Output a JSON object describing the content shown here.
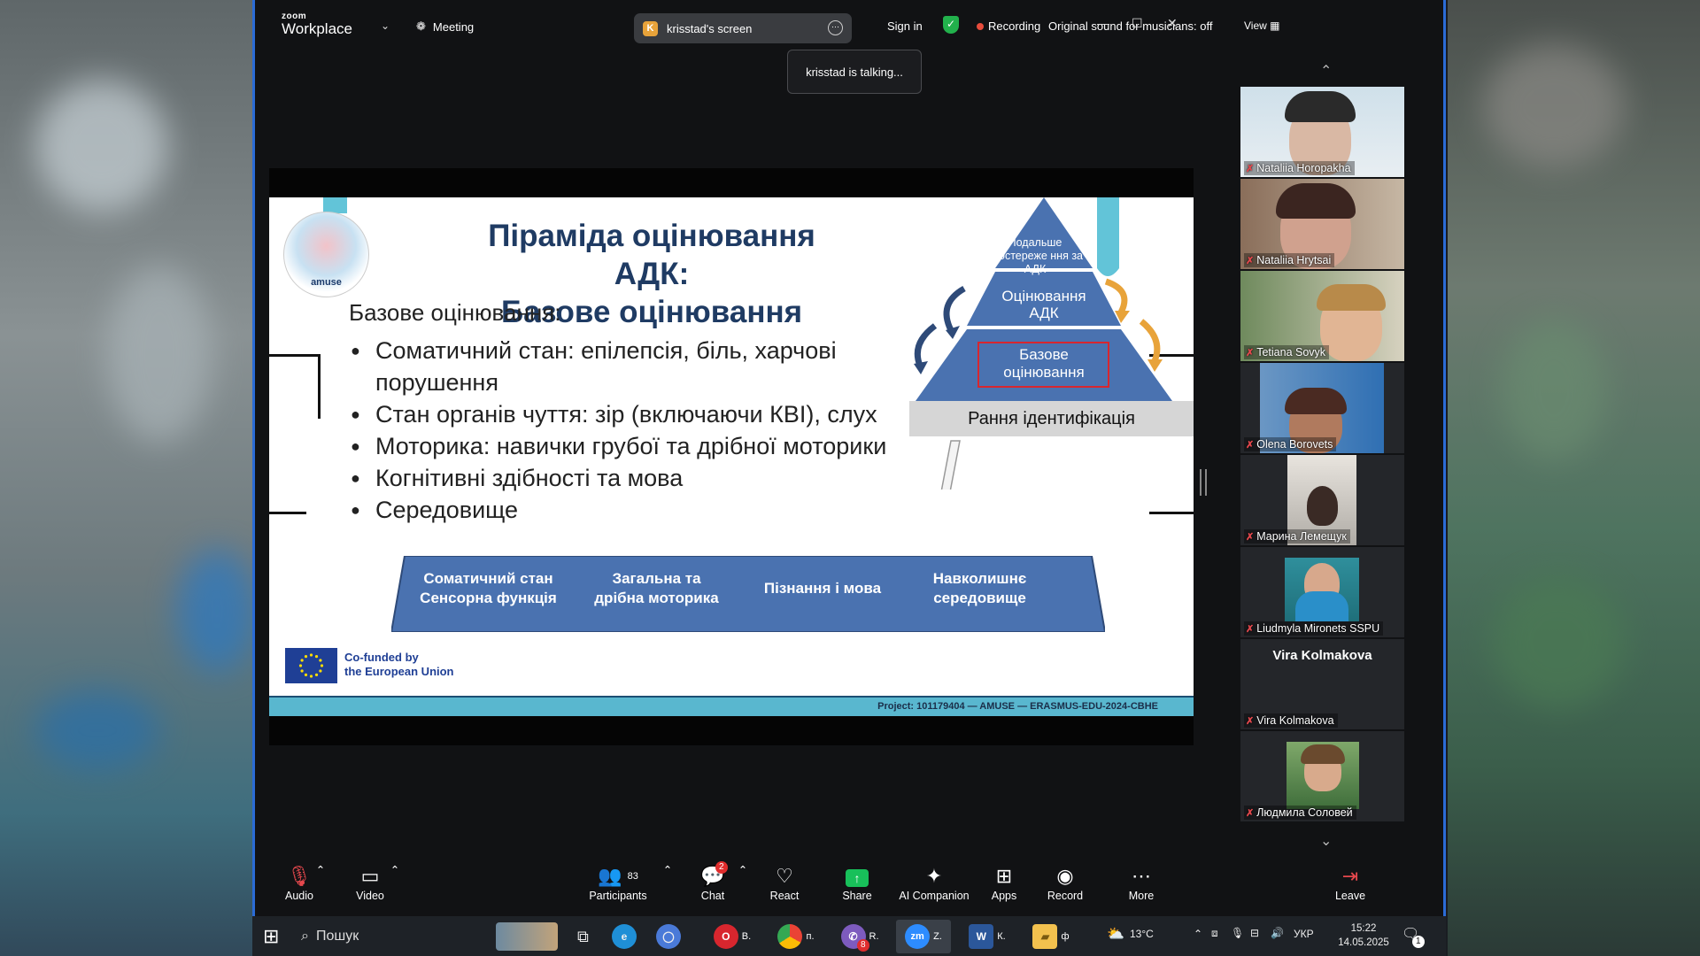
{
  "window": {
    "app_logo_small": "zoom",
    "app_logo_big": "Workplace",
    "meeting_label": "Meeting",
    "screen_pill_initial": "K",
    "screen_pill_label": "krisstad's screen",
    "sign_in": "Sign in",
    "recording": "Recording",
    "original_sound": "Original sound for musicians: off",
    "view": "View",
    "talking_tooltip": "krisstad is talking..."
  },
  "slide": {
    "title_line1": "Піраміда оцінювання АДК:",
    "title_line2": "Базове оцінювання",
    "logo_text": "amuse",
    "subheading": "Базове оцінювання:",
    "bullets": [
      "Соматичний стан: епілепсія, біль, харчові порушення",
      "Стан органів чуття: зір (включаючи КВІ), слух",
      "Моторика: навички грубої та дрібної моторики",
      "Когнітивні здібності та мова",
      "Середовище"
    ],
    "pyramid": {
      "top": "Подальше спостереже ння за АДК",
      "middle": "Оцінювання АДК",
      "bottom": "Базове оцінювання",
      "base_band": "Рання ідентифікація"
    },
    "bottom_labels": [
      "Соматичний стан Сенсорна функція",
      "Загальна та дрібна моторика",
      "Пізнання і мова",
      "Навколишнє середовище"
    ],
    "eu_text_line1": "Co-funded by",
    "eu_text_line2": "the European Union",
    "project_footer": "Project: 101179404 — AMUSE — ERASMUS-EDU-2024-CBHE",
    "colors": {
      "title": "#1f3b63",
      "pyramid": "#4a72b0",
      "band": "#59b7cf",
      "arrow_orange": "#e8a33a"
    }
  },
  "participants": {
    "tiles": [
      {
        "name": "Nataliia Horopakha"
      },
      {
        "name": "Nataliia Hrytsai"
      },
      {
        "name": "Tetiana Sovyk"
      },
      {
        "name": "Olena Borovets"
      },
      {
        "name": "Марина Лемещук"
      },
      {
        "name": "Liudmyla Mironets SSPU"
      },
      {
        "name": "Vira Kolmakova",
        "display_title": "Vira Kolmakova"
      },
      {
        "name": "Людмила Соловей"
      }
    ]
  },
  "toolbar": {
    "audio": "Audio",
    "video": "Video",
    "participants": "Participants",
    "participants_count": "83",
    "chat": "Chat",
    "chat_badge": "2",
    "react": "React",
    "share": "Share",
    "ai_companion": "AI Companion",
    "apps": "Apps",
    "record": "Record",
    "more": "More",
    "leave": "Leave"
  },
  "taskbar": {
    "search_placeholder": "Пошук",
    "apps": [
      {
        "letter": "В.",
        "icon": "opera-icon",
        "color": "#d8262e"
      },
      {
        "letter": "п.",
        "icon": "chrome-icon",
        "color": "#2fa84f"
      },
      {
        "letter": "R.",
        "icon": "viber-icon",
        "color": "#7d5bbe",
        "badge": "8"
      },
      {
        "letter": "Z.",
        "icon": "zoom-icon",
        "color": "#2d8cff"
      },
      {
        "letter": "К.",
        "icon": "word-icon",
        "color": "#2b579a"
      },
      {
        "letter": "ф",
        "icon": "folder-icon",
        "color": "#f2c14e"
      }
    ],
    "weather": "13°C",
    "lang": "УКР",
    "time": "15:22",
    "date": "14.05.2025",
    "notification_count": "1"
  }
}
